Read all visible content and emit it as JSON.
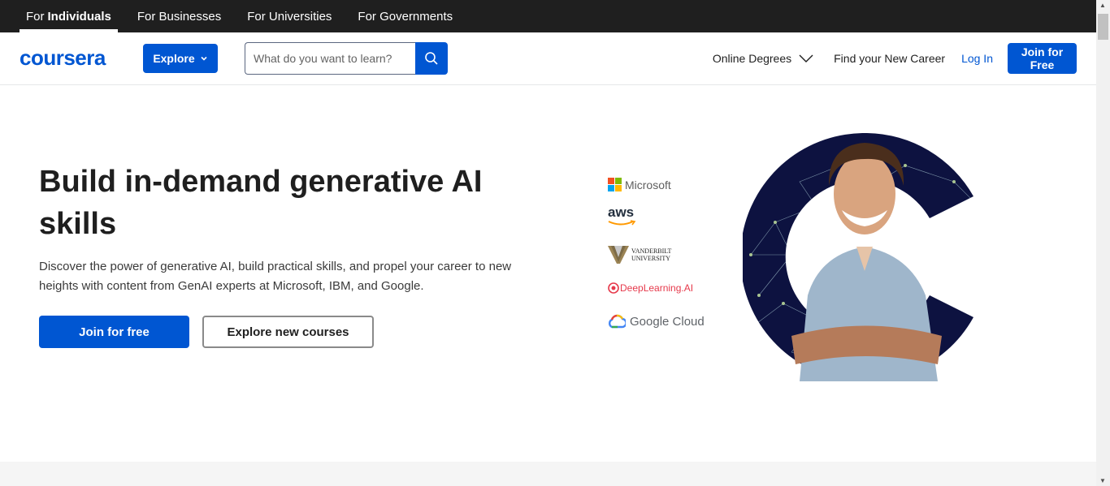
{
  "audience_tabs": [
    {
      "prefix": "For",
      "label": "Individuals",
      "active": true
    },
    {
      "label": "For Businesses"
    },
    {
      "label": "For Universities"
    },
    {
      "label": "For Governments"
    }
  ],
  "header": {
    "logo": "coursera",
    "explore_label": "Explore",
    "search_placeholder": "What do you want to learn?",
    "online_degrees": "Online Degrees",
    "find_career": "Find your New Career",
    "login": "Log In",
    "join": "Join for Free"
  },
  "hero": {
    "title": "Build in-demand generative AI skills",
    "subtitle": "Discover the power of generative AI, build practical skills, and propel your career to new heights with content from GenAI experts at Microsoft, IBM, and Google.",
    "primary_cta": "Join for free",
    "secondary_cta": "Explore new courses"
  },
  "partners": {
    "microsoft": "Microsoft",
    "aws": "aws",
    "vanderbilt_line1": "VANDERBILT",
    "vanderbilt_line2": "UNIVERSITY",
    "deeplearning": "DeepLearning.AI",
    "google_cloud": "Google Cloud"
  },
  "colors": {
    "brand": "#0056d2",
    "top_bar": "#1f1f1f",
    "deeplearning": "#e6394b"
  }
}
